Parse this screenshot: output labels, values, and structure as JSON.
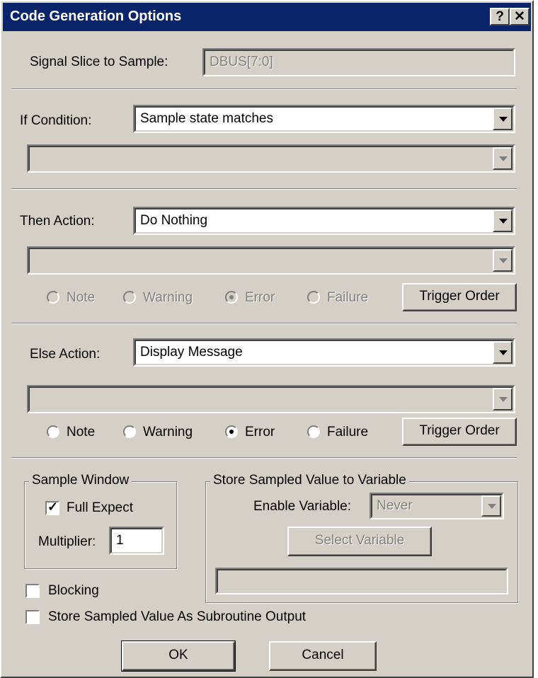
{
  "title": "Code Generation Options",
  "title_buttons": {
    "help": "?",
    "close": "✕"
  },
  "signal_slice": {
    "label": "Signal Slice to Sample:",
    "value": "DBUS[7:0]"
  },
  "if_condition": {
    "label": "If Condition:",
    "selected": "Sample state matches",
    "secondary": ""
  },
  "then_action": {
    "label": "Then Action:",
    "selected": "Do Nothing",
    "secondary": "",
    "severity": {
      "options": [
        "Note",
        "Warning",
        "Error",
        "Failure"
      ],
      "selected": "Error",
      "enabled": false
    },
    "trigger_order": "Trigger Order"
  },
  "else_action": {
    "label": "Else Action:",
    "selected": "Display Message",
    "secondary": "",
    "severity": {
      "options": [
        "Note",
        "Warning",
        "Error",
        "Failure"
      ],
      "selected": "Error",
      "enabled": true
    },
    "trigger_order": "Trigger Order"
  },
  "sample_window": {
    "title": "Sample Window",
    "full_expect_label": "Full Expect",
    "full_expect_checked": true,
    "multiplier_label": "Multiplier:",
    "multiplier_value": "1"
  },
  "store_variable": {
    "title": "Store Sampled Value to Variable",
    "enable_label": "Enable Variable:",
    "enable_value": "Never",
    "select_button": "Select Variable",
    "variable_value": ""
  },
  "blocking": {
    "label": "Blocking",
    "checked": false
  },
  "store_subroutine": {
    "label": "Store Sampled Value As Subroutine Output",
    "checked": false
  },
  "buttons": {
    "ok": "OK",
    "cancel": "Cancel"
  }
}
